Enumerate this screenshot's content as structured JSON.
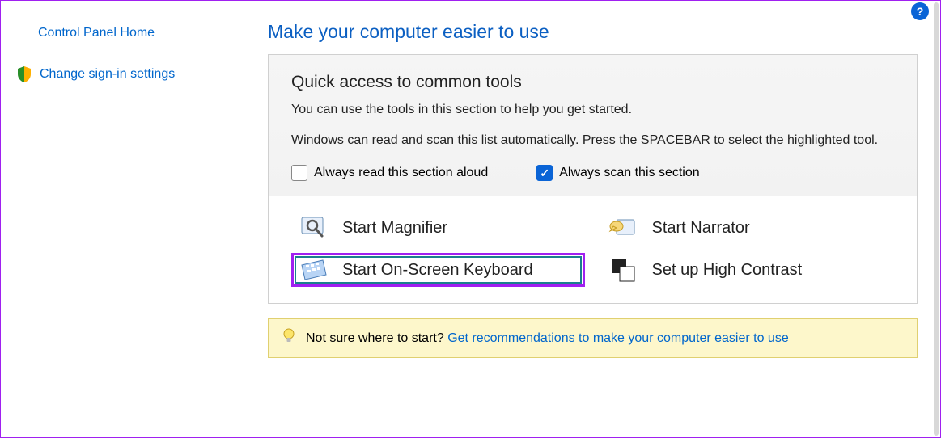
{
  "sidebar": {
    "home": "Control Panel Home",
    "signin": "Change sign-in settings"
  },
  "page": {
    "title": "Make your computer easier to use"
  },
  "quick": {
    "title": "Quick access to common tools",
    "desc1": "You can use the tools in this section to help you get started.",
    "desc2": "Windows can read and scan this list automatically.  Press the SPACEBAR to select the highlighted tool.",
    "cb_read": "Always read this section aloud",
    "cb_scan": "Always scan this section"
  },
  "tools": {
    "magnifier": "Start Magnifier",
    "narrator": "Start Narrator",
    "osk": "Start On-Screen Keyboard",
    "contrast": "Set up High Contrast"
  },
  "hint": {
    "prefix": "Not sure where to start? ",
    "link": "Get recommendations to make your computer easier to use"
  }
}
